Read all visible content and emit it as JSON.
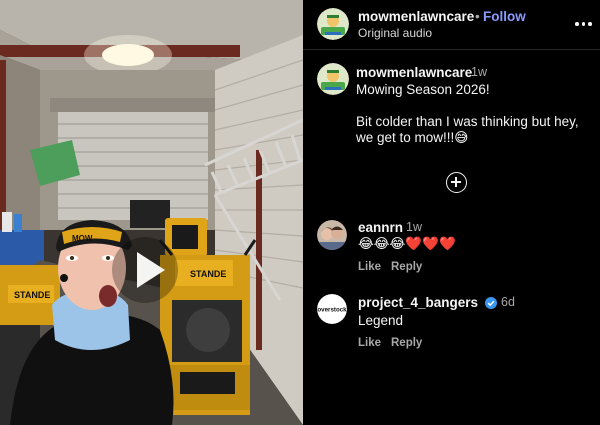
{
  "post": {
    "username": "mowmenlawncare",
    "dot": "•",
    "follow_label": "Follow",
    "audio_label": "Original audio",
    "more_icon": "more-horizontal-icon"
  },
  "caption": {
    "username": "mowmenlawncare",
    "time": "1w",
    "lines": [
      "Mowing Season 2026!",
      "",
      "Bit colder than I was thinking but hey,",
      "we get to mow!!!😅"
    ]
  },
  "load_more_icon": "plus-circle-icon",
  "comments": [
    {
      "username": "eannrn",
      "time": "1w",
      "text": "😂😂😂❤️❤️❤️",
      "like_label": "Like",
      "reply_label": "Reply",
      "verified": false
    },
    {
      "username": "project_4_bangers",
      "time": "6d",
      "text": "Legend",
      "like_label": "Like",
      "reply_label": "Reply",
      "verified": true,
      "avatar_text": "overstock"
    }
  ],
  "video": {
    "cap_text": "MOW",
    "mower_brand_left": "STANDE",
    "mower_brand_right": "STANDE",
    "play_icon": "play-icon"
  },
  "colors": {
    "follow": "#8a9bff",
    "verified": "#3897f0",
    "mower_yellow": "#e0a418"
  }
}
